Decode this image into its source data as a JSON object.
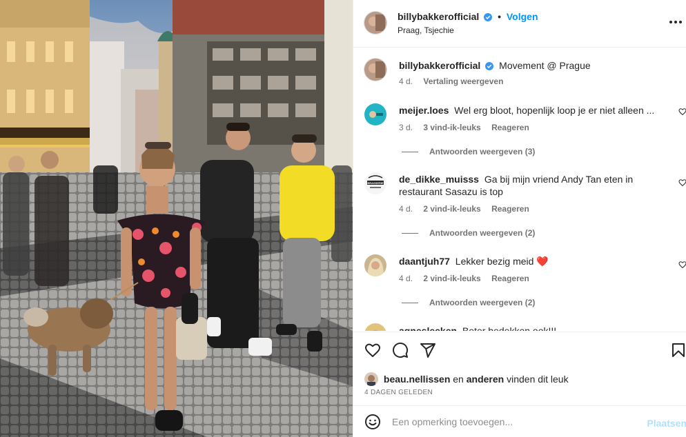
{
  "post": {
    "author": "billybakkerofficial",
    "follow_label": "Volgen",
    "separator": "•",
    "location": "Praag, Tsjechie",
    "caption": "Movement @ Prague",
    "caption_time": "4 d.",
    "translate_label": "Vertaling weergeven",
    "more_icon": "more-horizontal-icon"
  },
  "comments": [
    {
      "username": "meijer.loes",
      "text": "Wel erg bloot, hopenlijk loop je er niet alleen ...",
      "time": "3 d.",
      "likes": "3 vind-ik-leuks",
      "reply_label": "Reageren",
      "view_replies": "Antwoorden weergeven (3)"
    },
    {
      "username": "de_dikke_muisss",
      "text": "Ga bij mijn vriend Andy Tan eten in restaurant Sasazu is top",
      "time": "4 d.",
      "likes": "2 vind-ik-leuks",
      "reply_label": "Reageren",
      "view_replies": "Antwoorden weergeven (2)",
      "avatar_text": "BRASSERIE"
    },
    {
      "username": "daantjuh77",
      "text": "Lekker bezig meid ❤️",
      "time": "4 d.",
      "likes": "2 vind-ik-leuks",
      "reply_label": "Reageren",
      "view_replies": "Antwoorden weergeven (2)"
    },
    {
      "username": "agnesleeken",
      "text": "Beter bedekken ook!!!"
    }
  ],
  "liked_by": {
    "user": "beau.nellissen",
    "text_mid": "en",
    "others": "anderen",
    "text_end": "vinden dit leuk"
  },
  "date": "4 DAGEN GELEDEN",
  "add_comment": {
    "placeholder": "Een opmerking toevoegen...",
    "post_label": "Plaatsen"
  },
  "colors": {
    "accent": "#0095f6",
    "post_disabled": "#b2dffc",
    "text": "#262626",
    "muted": "#737373",
    "heart_red": "#ed4956"
  }
}
